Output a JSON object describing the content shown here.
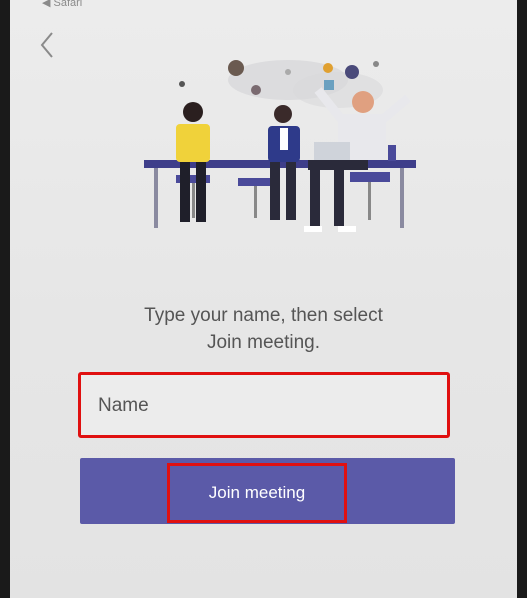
{
  "status_bar": {
    "carrier": "◀ Safari"
  },
  "prompt": {
    "line1": "Type your name, then select",
    "line2": "Join meeting."
  },
  "name_field": {
    "placeholder": "Name",
    "value": ""
  },
  "join_button": {
    "label": "Join meeting"
  },
  "colors": {
    "accent": "#5b5aa8",
    "highlight": "#e01010"
  }
}
